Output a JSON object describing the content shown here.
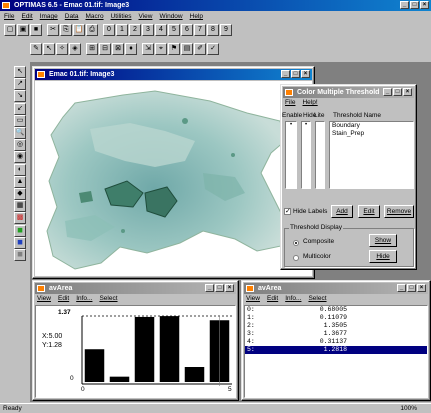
{
  "app": {
    "title": "OPTIMAS 6.5 - Emac 01.tif: Image3",
    "menu": [
      "File",
      "Edit",
      "Image",
      "Data",
      "Macro",
      "Utilities",
      "View",
      "Window",
      "Help"
    ]
  },
  "toolbar": {
    "row1": [
      "new",
      "open",
      "save",
      "cut",
      "copy",
      "paste",
      "print",
      "0",
      "1",
      "2",
      "3",
      "4",
      "5",
      "6",
      "7",
      "8",
      "9"
    ],
    "row2": [
      "tool-a",
      "tool-b",
      "tool-c",
      "tool-d",
      "tool-e",
      "tool-f",
      "tool-g",
      "tool-h",
      "tool-i",
      "tool-j",
      "tool-k",
      "tool-l",
      "tool-m",
      "tool-n"
    ]
  },
  "image_window": {
    "title": "Emac 01.tif: Image3"
  },
  "threshold_dialog": {
    "title": "Color Multiple Threshold",
    "menu": [
      "File",
      "Help!"
    ],
    "col_enable": "Enable",
    "col_hide": "Hide",
    "col_lite": "Lite",
    "col_name": "Threshold Name",
    "thresholds": [
      "Boundary",
      "Stain_Prep"
    ],
    "hide_labels": "Hide Labels",
    "add": "Add",
    "edit": "Edit",
    "remove": "Remove",
    "display_group": "Threshold Display",
    "composite": "Composite",
    "multicolor": "Multicolor",
    "show": "Show",
    "hide": "Hide"
  },
  "chart_window": {
    "title": "avArea",
    "menu": [
      "View",
      "Edit",
      "Info...",
      "Select"
    ],
    "ymax_label": "1.37",
    "x_readout": "X:5.00",
    "y_readout": "Y:1.28",
    "x0": "0",
    "x5": "5",
    "y0": "0"
  },
  "chart_data": {
    "type": "bar",
    "categories": [
      "0",
      "1",
      "2",
      "3",
      "4",
      "5"
    ],
    "values": [
      0.68005,
      0.11079,
      1.3505,
      1.3677,
      0.31137,
      1.2818
    ],
    "ylim": [
      0,
      1.37
    ],
    "highlight_index": 5
  },
  "list_window": {
    "title": "avArea",
    "menu": [
      "View",
      "Edit",
      "Info...",
      "Select"
    ],
    "rows": [
      {
        "idx": "0:",
        "val": "0.68005"
      },
      {
        "idx": "1:",
        "val": "0.11079"
      },
      {
        "idx": "2:",
        "val": "1.3505"
      },
      {
        "idx": "3:",
        "val": "1.3677"
      },
      {
        "idx": "4:",
        "val": "0.31137"
      },
      {
        "idx": "5:",
        "val": "1.2818"
      }
    ],
    "selected_index": 5
  },
  "status": {
    "text": "Ready",
    "zoom": "100%"
  }
}
